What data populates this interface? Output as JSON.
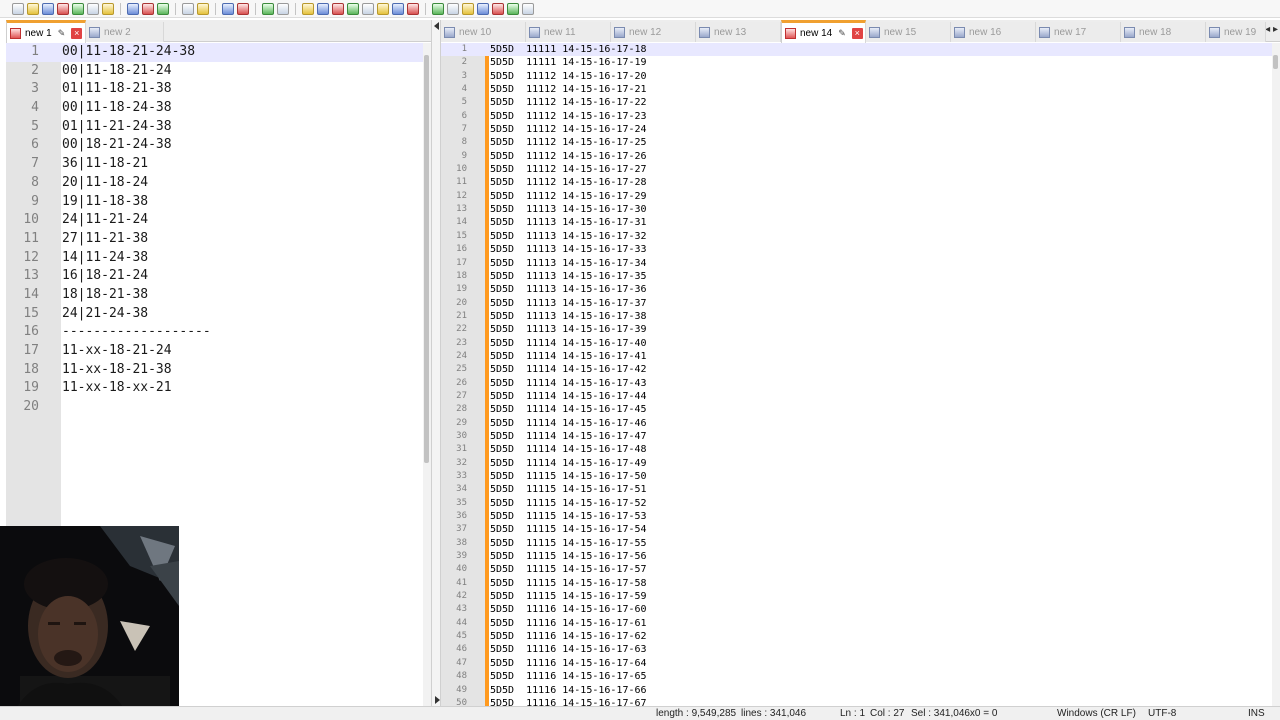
{
  "toolbar": {
    "buttons": [
      "new-file-icon",
      "open-file-icon",
      "save-icon",
      "save-all-icon",
      "close-icon",
      "close-all-icon",
      "print-icon",
      "cut-icon",
      "copy-icon",
      "paste-icon",
      "undo-icon",
      "redo-icon",
      "find-icon",
      "replace-icon",
      "zoom-in-icon",
      "zoom-out-icon",
      "sync-v-icon",
      "sync-h-icon",
      "word-wrap-icon",
      "all-chars-icon",
      "indent-guide-icon",
      "lang-icon",
      "doc-map-icon",
      "func-list-icon",
      "folder-icon",
      "monitor-icon",
      "record-icon",
      "stop-icon",
      "play-icon",
      "play-multi-icon",
      "save-macro-icon"
    ]
  },
  "left_pane": {
    "tabs": [
      {
        "label": "new 1",
        "active": true,
        "modified": true
      },
      {
        "label": "new 2",
        "active": false,
        "modified": false
      }
    ],
    "lines": [
      "00|11-18-21-24-38",
      "00|11-18-21-24",
      "01|11-18-21-38",
      "00|11-18-24-38",
      "01|11-21-24-38",
      "00|18-21-24-38",
      "36|11-18-21",
      "20|11-18-24",
      "19|11-18-38",
      "24|11-21-24",
      "27|11-21-38",
      "14|11-24-38",
      "16|18-21-24",
      "18|18-21-38",
      "24|21-24-38",
      "-------------------",
      "11-xx-18-21-24",
      "11-xx-18-21-38",
      "11-xx-18-xx-21",
      ""
    ]
  },
  "right_pane": {
    "tabs": [
      {
        "label": "new 10",
        "active": false,
        "modified": false
      },
      {
        "label": "new 11",
        "active": false,
        "modified": false
      },
      {
        "label": "new 12",
        "active": false,
        "modified": false
      },
      {
        "label": "new 13",
        "active": false,
        "modified": false
      },
      {
        "label": "new 14",
        "active": true,
        "modified": true
      },
      {
        "label": "new 15",
        "active": false,
        "modified": false
      },
      {
        "label": "new 16",
        "active": false,
        "modified": false
      },
      {
        "label": "new 17",
        "active": false,
        "modified": false
      },
      {
        "label": "new 18",
        "active": false,
        "modified": false
      },
      {
        "label": "new 19",
        "active": false,
        "modified": false
      }
    ],
    "tab_nav": "◂ ▸",
    "lines": [
      "5D5D  11111 14-15-16-17-18",
      "5D5D  11111 14-15-16-17-19",
      "5D5D  11112 14-15-16-17-20",
      "5D5D  11112 14-15-16-17-21",
      "5D5D  11112 14-15-16-17-22",
      "5D5D  11112 14-15-16-17-23",
      "5D5D  11112 14-15-16-17-24",
      "5D5D  11112 14-15-16-17-25",
      "5D5D  11112 14-15-16-17-26",
      "5D5D  11112 14-15-16-17-27",
      "5D5D  11112 14-15-16-17-28",
      "5D5D  11112 14-15-16-17-29",
      "5D5D  11113 14-15-16-17-30",
      "5D5D  11113 14-15-16-17-31",
      "5D5D  11113 14-15-16-17-32",
      "5D5D  11113 14-15-16-17-33",
      "5D5D  11113 14-15-16-17-34",
      "5D5D  11113 14-15-16-17-35",
      "5D5D  11113 14-15-16-17-36",
      "5D5D  11113 14-15-16-17-37",
      "5D5D  11113 14-15-16-17-38",
      "5D5D  11113 14-15-16-17-39",
      "5D5D  11114 14-15-16-17-40",
      "5D5D  11114 14-15-16-17-41",
      "5D5D  11114 14-15-16-17-42",
      "5D5D  11114 14-15-16-17-43",
      "5D5D  11114 14-15-16-17-44",
      "5D5D  11114 14-15-16-17-45",
      "5D5D  11114 14-15-16-17-46",
      "5D5D  11114 14-15-16-17-47",
      "5D5D  11114 14-15-16-17-48",
      "5D5D  11114 14-15-16-17-49",
      "5D5D  11115 14-15-16-17-50",
      "5D5D  11115 14-15-16-17-51",
      "5D5D  11115 14-15-16-17-52",
      "5D5D  11115 14-15-16-17-53",
      "5D5D  11115 14-15-16-17-54",
      "5D5D  11115 14-15-16-17-55",
      "5D5D  11115 14-15-16-17-56",
      "5D5D  11115 14-15-16-17-57",
      "5D5D  11115 14-15-16-17-58",
      "5D5D  11115 14-15-16-17-59",
      "5D5D  11116 14-15-16-17-60",
      "5D5D  11116 14-15-16-17-61",
      "5D5D  11116 14-15-16-17-62",
      "5D5D  11116 14-15-16-17-63",
      "5D5D  11116 14-15-16-17-64",
      "5D5D  11116 14-15-16-17-65",
      "5D5D  11116 14-15-16-17-66",
      "5D5D  11116 14-15-16-17-67"
    ]
  },
  "statusbar": {
    "length": "length : 9,549,285",
    "lines": "lines : 341,046",
    "ln": "Ln : 1",
    "col": "Col : 27",
    "sel": "Sel : 341,046x0 = 0",
    "eol": "Windows (CR LF)",
    "encoding": "UTF-8",
    "mode": "INS"
  },
  "colors": {
    "fold_bar": "#ff9a1f",
    "active_tab_accent": "#f0a030",
    "current_line": "#e8e8ff",
    "gutter": "#e4e4e4"
  }
}
